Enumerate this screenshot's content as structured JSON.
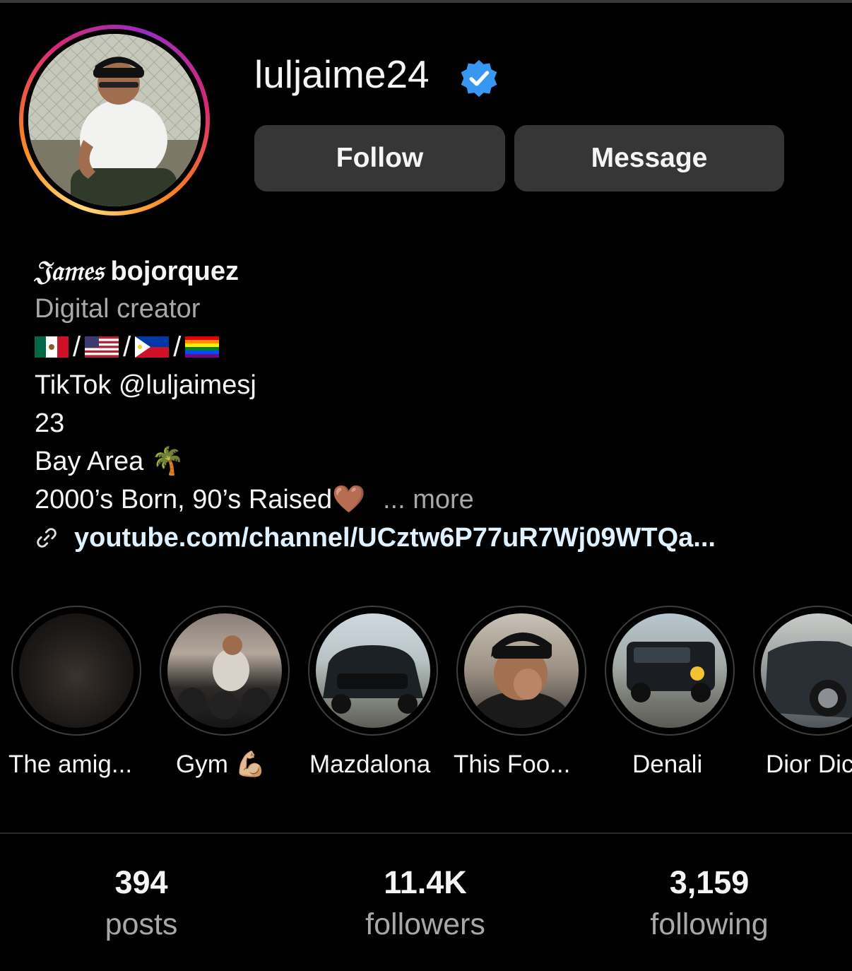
{
  "profile": {
    "username": "luljaime24",
    "verified_icon": "verified-badge-icon",
    "accent_color": "#3897f0"
  },
  "actions": {
    "follow_label": "Follow",
    "message_label": "Message"
  },
  "bio": {
    "name_fancy": "𝔍𝔞𝔪𝔢𝔰",
    "name_rest": "bojorquez",
    "category": "Digital creator",
    "flags": [
      "mexico-flag",
      "usa-flag",
      "philippines-flag",
      "pride-flag"
    ],
    "flag_separator": "/",
    "tiktok": "TikTok @luljaimesj",
    "age": "23",
    "location": "Bay Area 🌴",
    "tagline": "2000’s Born, 90’s Raised🤎",
    "more_label": "... more",
    "link": "youtube.com/channel/UCztw6P77uR7Wj09WTQa..."
  },
  "highlights": [
    {
      "label": "The amig..."
    },
    {
      "label": "Gym 💪🏼"
    },
    {
      "label": "Mazdalona"
    },
    {
      "label": "This Foo..."
    },
    {
      "label": "Denali"
    },
    {
      "label": "Dior Dic"
    }
  ],
  "stats": {
    "posts": {
      "value": "394",
      "label": "posts"
    },
    "followers": {
      "value": "11.4K",
      "label": "followers"
    },
    "following": {
      "value": "3,159",
      "label": "following"
    }
  }
}
